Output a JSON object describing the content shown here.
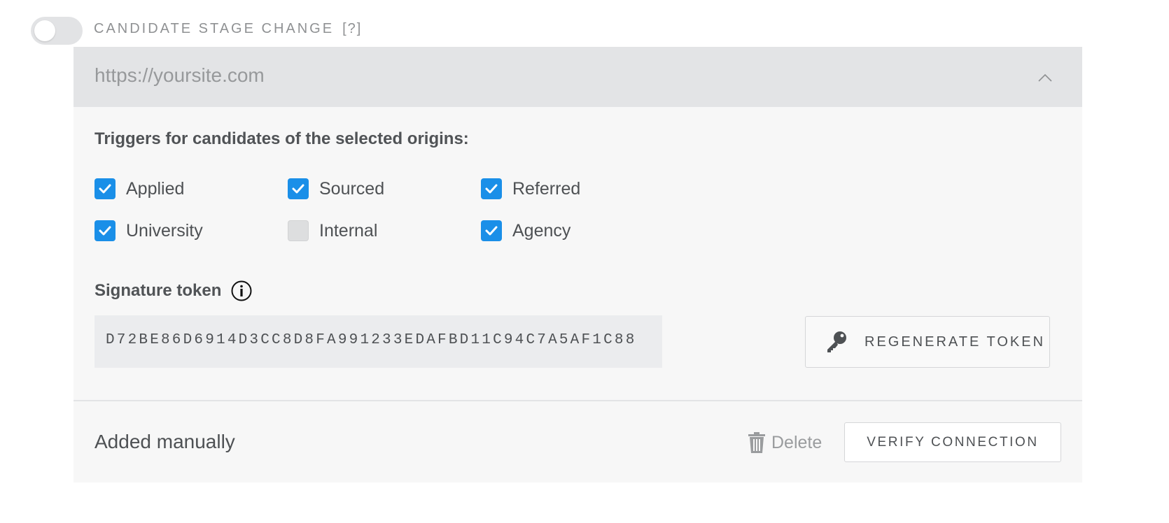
{
  "header": {
    "title": "CANDIDATE STAGE CHANGE",
    "help": "[?]"
  },
  "webhook": {
    "url": "https://yoursite.com",
    "expanded": true
  },
  "triggers": {
    "label": "Triggers for candidates of the selected origins:",
    "options": [
      {
        "label": "Applied",
        "checked": true
      },
      {
        "label": "Sourced",
        "checked": true
      },
      {
        "label": "Referred",
        "checked": true
      },
      {
        "label": "University",
        "checked": true
      },
      {
        "label": "Internal",
        "checked": false
      },
      {
        "label": "Agency",
        "checked": true
      }
    ]
  },
  "signature": {
    "label": "Signature token",
    "token": "D72BE86D6914D3CC8D8FA991233EDAFBD11C94C7A5AF1C88",
    "regenerate_label": "REGENERATE TOKEN"
  },
  "footer": {
    "added_text": "Added manually",
    "delete_label": "Delete",
    "verify_label": "VERIFY CONNECTION"
  },
  "colors": {
    "accent": "#1a8fe8",
    "panel_bg": "#f7f7f7",
    "url_bar_bg": "#e3e4e6"
  }
}
